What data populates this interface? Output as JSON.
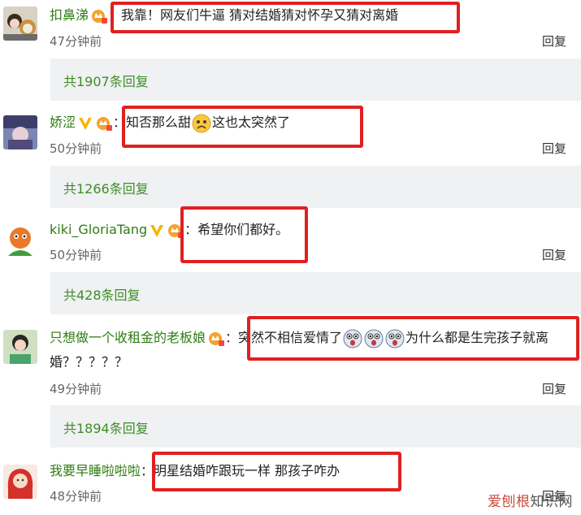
{
  "comments": [
    {
      "username": "扣鼻涕",
      "colon": "：",
      "text": "我靠！网友们牛逼 猜对结婚猜对怀孕又猜对离婚",
      "time": "47分钟前",
      "reply_label": "回复",
      "replies": "共1907条回复"
    },
    {
      "username": "娇涩",
      "colon": "：",
      "text_before": "知否那么甜",
      "text_after": "这也太突然了",
      "emoji": "sad-face-emoji",
      "time": "50分钟前",
      "reply_label": "回复",
      "replies": "共1266条回复"
    },
    {
      "username": "kiki_GloriaTang",
      "colon": "：",
      "text": "希望你们都好。",
      "time": "50分钟前",
      "reply_label": "回复",
      "replies": "共428条回复"
    },
    {
      "username": "只想做一个收租金的老板娘",
      "colon": "：",
      "text_before": "突然不相信爱情了",
      "text_after": "为什么都是生完孩子就离",
      "text_cont": "婚？？？？？",
      "emoji": "shocked-face-emoji",
      "time": "49分钟前",
      "reply_label": "回复",
      "replies": "共1894条回复"
    },
    {
      "username": "我要早睡啦啦啦",
      "colon": "：",
      "text": "明星结婚咋跟玩一样 那孩子咋办",
      "time": "48分钟前",
      "reply_label": "回复"
    }
  ],
  "watermark": {
    "part1": "爱刨根",
    "part2": "知识网"
  },
  "colors": {
    "username": "#2e7d12",
    "highlight": "#e02020",
    "replies_bar": "#eff1f3"
  }
}
